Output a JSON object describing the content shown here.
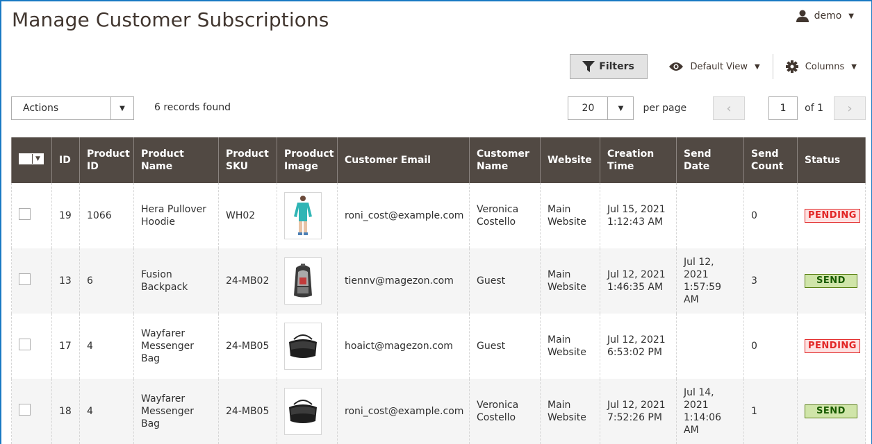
{
  "page": {
    "title": "Manage Customer Subscriptions"
  },
  "user": {
    "name": "demo"
  },
  "toolbar": {
    "filters": "Filters",
    "view": "Default View",
    "columns": "Columns"
  },
  "actions": {
    "label": "Actions"
  },
  "records": "6 records found",
  "pager": {
    "per_page_value": "20",
    "per_page_label": "per page",
    "current": "1",
    "of": "of 1"
  },
  "table": {
    "columns": [
      "ID",
      "Product ID",
      "Product Name",
      "Product SKU",
      "Prooduct Image",
      "Customer Email",
      "Customer Name",
      "Website",
      "Creation Time",
      "Send Date",
      "Send Count",
      "Status"
    ],
    "rows": [
      {
        "id": "19",
        "product_id": "1066",
        "product_name": "Hera Pullover Hoodie",
        "sku": "WH02",
        "image": "teal-hoodie",
        "email": "roni_cost@example.com",
        "customer": "Veronica Costello",
        "website": "Main Website",
        "created_date": "Jul 15, 2021",
        "created_time": "1:12:43 AM",
        "send_date": "",
        "send_time": "",
        "send_count": "0",
        "status": "PENDING"
      },
      {
        "id": "13",
        "product_id": "6",
        "product_name": "Fusion Backpack",
        "sku": "24-MB02",
        "image": "backpack",
        "email": "tiennv@magezon.com",
        "customer": "Guest",
        "website": "Main Website",
        "created_date": "Jul 12, 2021",
        "created_time": "1:46:35 AM",
        "send_date": "Jul 12, 2021",
        "send_time": "1:57:59 AM",
        "send_count": "3",
        "status": "SEND"
      },
      {
        "id": "17",
        "product_id": "4",
        "product_name": "Wayfarer Messenger Bag",
        "sku": "24-MB05",
        "image": "messenger-bag",
        "email": "hoaict@magezon.com",
        "customer": "Guest",
        "website": "Main Website",
        "created_date": "Jul 12, 2021",
        "created_time": "6:53:02 PM",
        "send_date": "",
        "send_time": "",
        "send_count": "0",
        "status": "PENDING"
      },
      {
        "id": "18",
        "product_id": "4",
        "product_name": "Wayfarer Messenger Bag",
        "sku": "24-MB05",
        "image": "messenger-bag",
        "email": "roni_cost@example.com",
        "customer": "Veronica Costello",
        "website": "Main Website",
        "created_date": "Jul 12, 2021",
        "created_time": "7:52:26 PM",
        "send_date": "Jul 14, 2021",
        "send_time": "1:14:06 AM",
        "send_count": "1",
        "status": "SEND"
      }
    ]
  },
  "colors": {
    "header_bg": "#514943",
    "pending": "#e22626",
    "send": "#185b00"
  }
}
